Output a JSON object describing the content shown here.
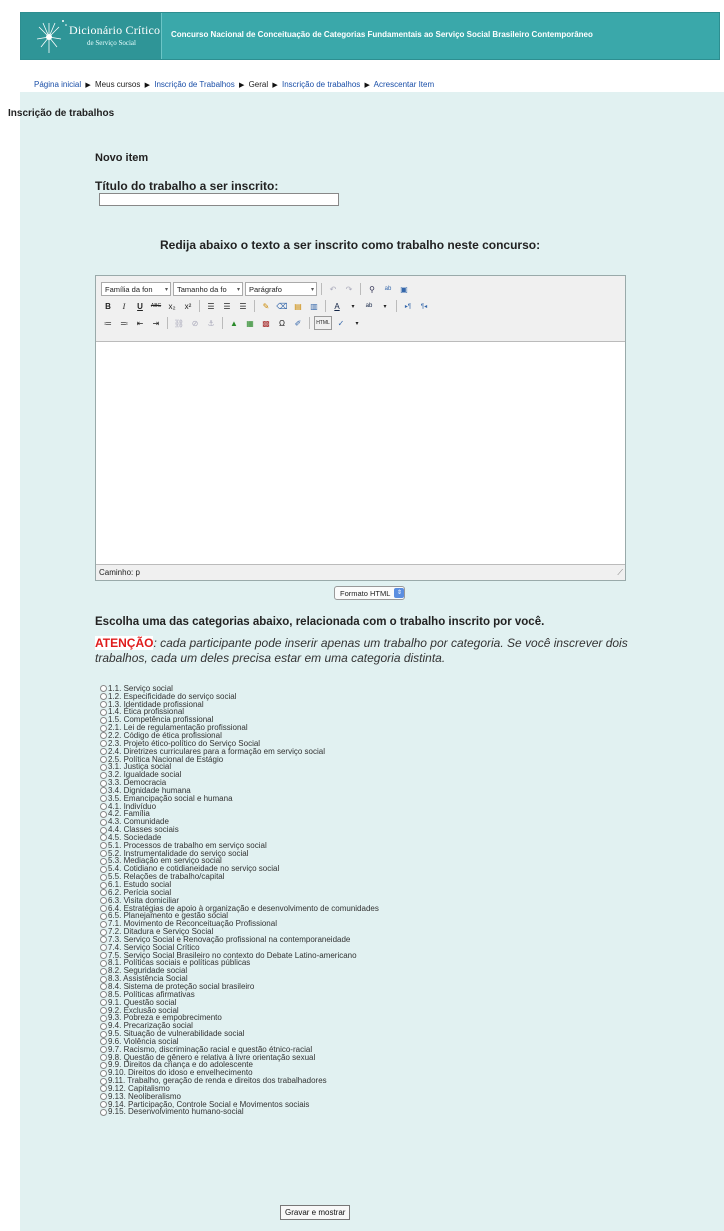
{
  "header": {
    "logo_title": "Dicionário Crítico",
    "logo_subtitle": "de Serviço Social",
    "site_title": "Concurso Nacional de Conceituação de Categorias Fundamentais ao Serviço Social Brasileiro Contemporâneo"
  },
  "breadcrumb": {
    "items": [
      "Página inicial",
      "Meus cursos",
      "Inscrição de Trabalhos",
      "Geral",
      "Inscrição de trabalhos",
      "Acrescentar Item"
    ]
  },
  "section_title": "Inscrição de trabalhos",
  "form": {
    "novo_item": "Novo item",
    "titulo_label": "Título do trabalho a ser inscrito:",
    "titulo_value": "",
    "redija_label": "Redija abaixo o texto a ser inscrito como trabalho neste concurso:",
    "editor": {
      "font_family": "Família da fon",
      "font_size": "Tamanho da fo",
      "paragraph": "Parágrafo",
      "path_label": "Caminho: p"
    },
    "formato": "Formato HTML",
    "escolha": "Escolha uma das categorias abaixo, relacionada com o trabalho inscrito por você.",
    "atencao_label": "ATENÇÃO",
    "atencao_text": ": cada participante pode inserir apenas um trabalho por categoria. Se você inscrever dois trabalhos, cada um deles precisa estar em uma categoria distinta.",
    "submit": "Gravar e mostrar"
  },
  "categories": [
    "1.1. Serviço social",
    "1.2. Especificidade do serviço social",
    "1.3. Identidade profissional",
    "1.4. Ética profissional",
    "1.5. Competência profissional",
    "2.1. Lei de regulamentação profissional",
    "2.2. Código de ética profissional",
    "2.3. Projeto ético-político do Serviço Social",
    "2.4. Diretrizes curriculares para a formação em serviço social",
    "2.5. Política Nacional de Estágio",
    "3.1. Justiça social",
    "3.2. Igualdade social",
    "3.3. Democracia",
    "3.4. Dignidade humana",
    "3.5. Emancipação social e humana",
    "4.1. Indivíduo",
    "4.2. Família",
    "4.3. Comunidade",
    "4.4. Classes sociais",
    "4.5. Sociedade",
    "5.1. Processos de trabalho em serviço social",
    "5.2. Instrumentalidade do serviço social",
    "5.3. Mediação em serviço social",
    "5.4. Cotidiano e cotidianeidade no serviço social",
    "5.5. Relações de trabalho/capital",
    "6.1. Estudo social",
    "6.2. Perícia social",
    "6.3. Visita domiciliar",
    "6.4. Estratégias de apoio à organização e desenvolvimento de comunidades",
    "6.5. Planejamento e gestão social",
    "7.1. Movimento de Reconceituação Profissional",
    "7.2. Ditadura e Serviço Social",
    "7.3. Serviço Social e Renovação profissional na contemporaneidade",
    "7.4. Serviço Social Crítico",
    "7.5. Serviço Social Brasileiro no contexto do Debate Latino-americano",
    "8.1. Políticas sociais e políticas públicas",
    "8.2. Seguridade social",
    "8.3. Assistência Social",
    "8.4. Sistema de proteção social brasileiro",
    "8.5. Políticas afirmativas",
    "9.1. Questão social",
    "9.2. Exclusão social",
    "9.3. Pobreza e empobrecimento",
    "9.4. Precarização social",
    "9.5. Situação de vulnerabilidade social",
    "9.6. Violência social",
    "9.7. Racismo, discriminação racial e questão étnico-racial",
    "9.8. Questão de gênero e relativa à livre orientação sexual",
    "9.9. Direitos da criança e do adolescente",
    "9.10. Direitos do idoso e envelhecimento",
    "9.11. Trabalho, geração de renda e direitos dos trabalhadores",
    "9.12. Capitalismo",
    "9.13. Neoliberalismo",
    "9.14. Participação, Controle Social e Movimentos sociais",
    "9.15. Desenvolvimento humano-social"
  ]
}
